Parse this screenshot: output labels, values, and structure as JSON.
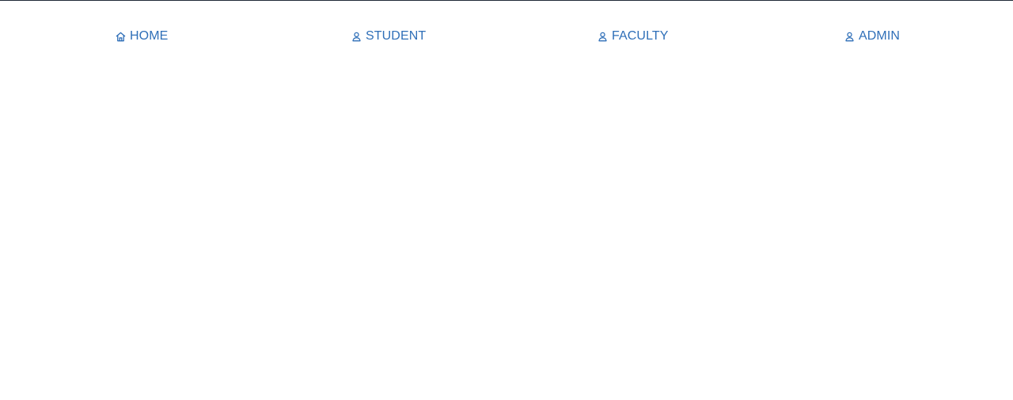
{
  "colors": {
    "nav_text": "#2f6fb8",
    "top_border": "#1f2a36",
    "background": "#ffffff"
  },
  "nav": {
    "items": [
      {
        "label": "HOME",
        "icon": "home-icon"
      },
      {
        "label": "STUDENT",
        "icon": "user-icon"
      },
      {
        "label": "FACULTY",
        "icon": "user-icon"
      },
      {
        "label": "ADMIN",
        "icon": "user-icon"
      }
    ]
  }
}
